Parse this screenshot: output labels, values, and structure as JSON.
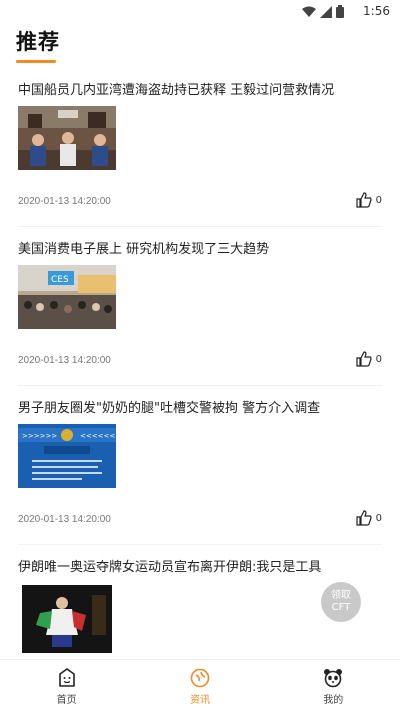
{
  "status_bar": {
    "time": "1:56"
  },
  "page": {
    "title": "推荐",
    "accent_color": "#f08a24"
  },
  "articles": [
    {
      "headline": "中国船员几内亚湾遭海盗劫持已获释 王毅过问营救情况",
      "timestamp": "2020-01-13 14:20:00",
      "likes": "0",
      "thumbnail": "meeting-room-photo"
    },
    {
      "headline": "美国消费电子展上 研究机构发现了三大趋势",
      "timestamp": "2020-01-13 14:20:00",
      "likes": "0",
      "thumbnail": "ces-expo-photo"
    },
    {
      "headline": "男子朋友圈发\"奶奶的腿\"吐槽交警被拘 警方介入调查",
      "timestamp": "2020-01-13 14:20:00",
      "likes": "0",
      "thumbnail": "police-notice-image"
    },
    {
      "headline": "伊朗唯一奥运夺牌女运动员宣布离开伊朗:我只是工具",
      "thumbnail": "athlete-photo"
    }
  ],
  "floating_button": {
    "line1": "领取",
    "line2": "CFT"
  },
  "tabs": [
    {
      "label": "首页",
      "icon": "home-face-icon",
      "active": false
    },
    {
      "label": "资讯",
      "icon": "news-compass-icon",
      "active": true
    },
    {
      "label": "我的",
      "icon": "panda-profile-icon",
      "active": false
    }
  ]
}
